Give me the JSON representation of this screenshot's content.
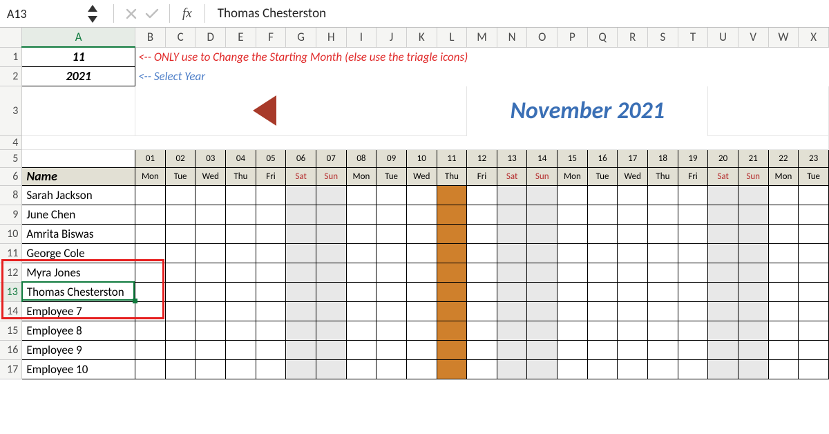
{
  "formula_bar": {
    "cell_ref": "A13",
    "fx_label": "fx",
    "content": "Thomas Chesterston"
  },
  "columns": [
    "A",
    "B",
    "C",
    "D",
    "E",
    "F",
    "G",
    "H",
    "I",
    "J",
    "K",
    "L",
    "M",
    "N",
    "O",
    "P",
    "Q",
    "R",
    "S",
    "T",
    "U",
    "V",
    "W",
    "X"
  ],
  "rows_shown": [
    "1",
    "2",
    "3",
    "4",
    "5",
    "6",
    "8",
    "9",
    "10",
    "11",
    "12",
    "13",
    "14",
    "15",
    "16",
    "17"
  ],
  "selected_cell": "A13",
  "inputs": {
    "month_number": "11",
    "year": "2021",
    "instr_month": "<-- ONLY use to Change the Starting Month (else use the triagle icons)",
    "instr_year": "<-- Select Year"
  },
  "month_title": "November 2021",
  "name_header": "Name",
  "day_numbers": [
    "01",
    "02",
    "03",
    "04",
    "05",
    "06",
    "07",
    "08",
    "09",
    "10",
    "11",
    "12",
    "13",
    "14",
    "15",
    "16",
    "17",
    "18",
    "19",
    "20",
    "21",
    "22",
    "23"
  ],
  "day_names": [
    "Mon",
    "Tue",
    "Wed",
    "Thu",
    "Fri",
    "Sat",
    "Sun",
    "Mon",
    "Tue",
    "Wed",
    "Thu",
    "Fri",
    "Sat",
    "Sun",
    "Mon",
    "Tue",
    "Wed",
    "Thu",
    "Fri",
    "Sat",
    "Sun",
    "Mon",
    "Tue"
  ],
  "employees": [
    "Sarah Jackson",
    "June Chen",
    "Amrita Biswas",
    "George Cole",
    "Myra Jones",
    "Thomas Chesterston",
    "Employee 7",
    "Employee 8",
    "Employee 9",
    "Employee 10"
  ],
  "holiday_col_index": 10,
  "weekend_indices": [
    5,
    6,
    12,
    13,
    19,
    20
  ]
}
